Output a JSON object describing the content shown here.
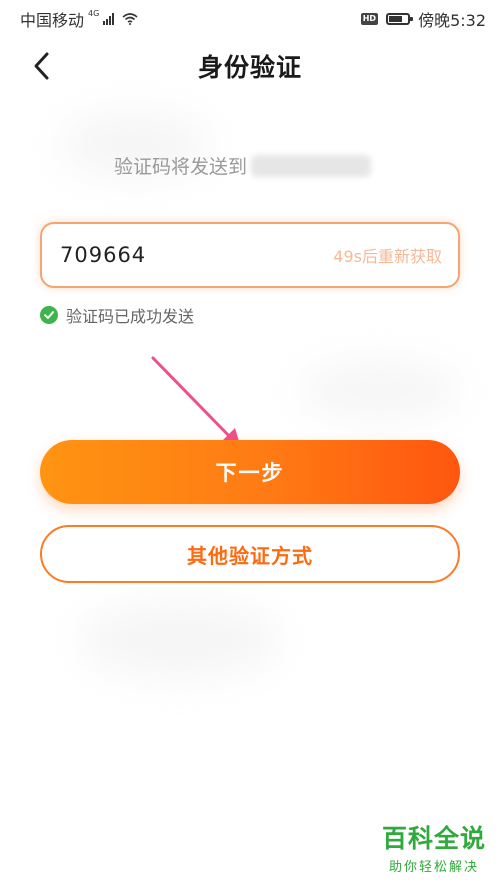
{
  "status_bar": {
    "carrier": "中国移动",
    "network": "4G",
    "hd": "HD",
    "time": "傍晚5:32"
  },
  "header": {
    "back_icon": "chevron-left-icon",
    "title": "身份验证"
  },
  "verification": {
    "sent_to_text": "验证码将发送到",
    "code_value": "709664",
    "resend_text": "49s后重新获取",
    "success_text": "验证码已成功发送"
  },
  "actions": {
    "next_label": "下一步",
    "other_methods_label": "其他验证方式"
  },
  "watermark": {
    "title": "百科全说",
    "subtitle": "助你轻松解决"
  },
  "colors": {
    "accent": "#ff7a14",
    "accent_dark": "#ff560f",
    "success": "#3cb54a",
    "annotation": "#ee4f8e"
  }
}
